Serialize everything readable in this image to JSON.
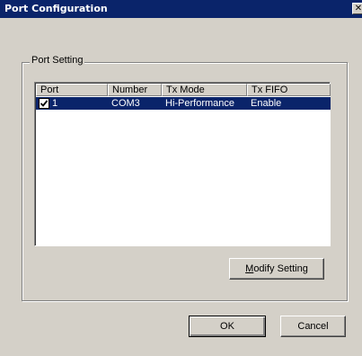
{
  "window": {
    "title": "Port Configuration",
    "close_glyph": "✕"
  },
  "group": {
    "label": "Port Setting"
  },
  "list": {
    "columns": [
      "Port",
      "Number",
      "Tx Mode",
      "Tx FIFO"
    ],
    "rows": [
      {
        "checked": true,
        "port": "1",
        "number": "COM3",
        "tx_mode": "Hi-Performance",
        "tx_fifo": "Enable",
        "selected": true
      }
    ]
  },
  "buttons": {
    "modify_mnemonic": "M",
    "modify_rest": "odify Setting",
    "ok": "OK",
    "cancel": "Cancel"
  },
  "colors": {
    "titlebar": "#0a246a",
    "face": "#d4d0c8",
    "selection": "#0a246a"
  },
  "icons": {
    "close": "close-icon",
    "checkbox": "checkmark-icon"
  }
}
